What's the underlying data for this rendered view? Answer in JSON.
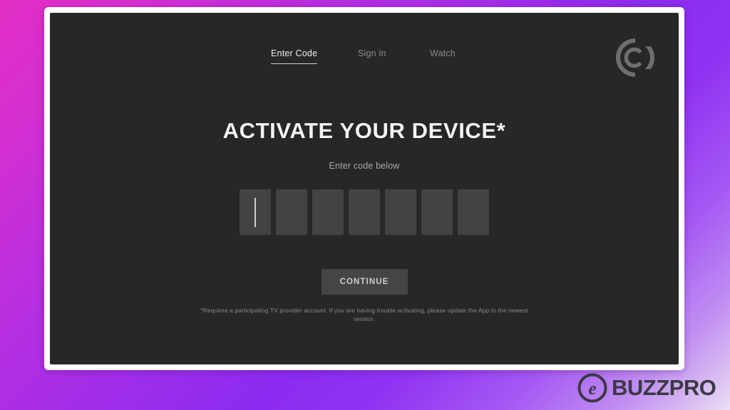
{
  "background": {
    "gradient_from": "#e22ec4",
    "gradient_mid": "#8b2bf0",
    "gradient_to": "#ece0f4"
  },
  "panel": {
    "frame_color": "#ffffff",
    "screen_color": "#272727"
  },
  "nav": {
    "items": [
      {
        "label": "Enter Code",
        "active": true
      },
      {
        "label": "Sign in",
        "active": false
      },
      {
        "label": "Watch",
        "active": false
      }
    ]
  },
  "brand": {
    "logo_name": "comedy-central-logo",
    "logo_color": "#6e6e6e"
  },
  "main": {
    "title": "ACTIVATE YOUR DEVICE*",
    "subtitle": "Enter code below",
    "code_input": {
      "length": 7,
      "values": [
        "",
        "",
        "",
        "",
        "",
        "",
        ""
      ],
      "focused_index": 0,
      "box_color": "#434343",
      "caret_color": "#cfcfcf"
    },
    "continue_label": "CONTINUE",
    "footnote": "*Requires a participating TV provider account. If you are having trouble activating, please update the App to the newest version."
  },
  "watermark": {
    "icon_name": "circled-e-icon",
    "text": "BUZZPRO",
    "color": "#3a3a42"
  }
}
